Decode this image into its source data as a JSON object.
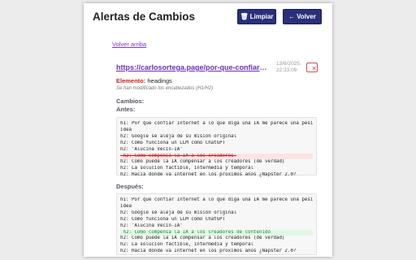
{
  "header": {
    "title": "Alertas de Cambios",
    "clear_label": "Limpiar",
    "back_label": "Volver",
    "clear_icon": "trash-icon",
    "back_icon": "arrow-left-icon"
  },
  "content": {
    "back_top": "Volver arriba",
    "url": "https://carlosortega.page/por-que-confiar-internet",
    "timestamp": "13/6/2025, 22:33:09",
    "close_glyph": "×",
    "element_label": "Elemento:",
    "element_value": "headings",
    "modified_text": "Se han modificado los encabezados (H1/H2)",
    "changes_label": "Cambios:",
    "before_label": "Antes:",
    "after_label": "Después:",
    "before_lines": [
      {
        "text": "h1: Por qué confiar Internet a lo que diga una IA me parece una pésima",
        "type": "normal"
      },
      {
        "text": "idea",
        "type": "normal"
      },
      {
        "text": "h2: Google se aleja de su misión original",
        "type": "normal"
      },
      {
        "text": "h2: Cómo funciona un LLM como ChatGPT",
        "type": "normal"
      },
      {
        "text": "h2: 'Alucina Vecin-IA'",
        "type": "normal"
      },
      {
        "text": " h2: Cómo compensa la IA a los creadores ",
        "type": "removed"
      },
      {
        "text": "h2: Cómo puede la IA compensar a los creadores (de verdad)",
        "type": "normal"
      },
      {
        "text": "h2: La solución factible, intermedia y temporal",
        "type": "normal"
      },
      {
        "text": "h2: Hacia dónde va Internet en los próximos años ¿Napster 2.0?",
        "type": "normal"
      }
    ],
    "after_lines": [
      {
        "text": "h1: Por qué confiar Internet a lo que diga una IA me parece una pésima",
        "type": "normal"
      },
      {
        "text": "idea",
        "type": "normal"
      },
      {
        "text": "h2: Google se aleja de su misión original",
        "type": "normal"
      },
      {
        "text": "h2: Cómo funciona un LLM como ChatGPT",
        "type": "normal"
      },
      {
        "text": "h2: 'Alucina Vecin-IA'",
        "type": "normal"
      },
      {
        "text": " h2: Cómo compensa la IA a los creadores de contenido ",
        "type": "added"
      },
      {
        "text": "h2: Cómo puede la IA compensar a los creadores (de verdad)",
        "type": "normal"
      },
      {
        "text": "h2: La solución factible, intermedia y temporal",
        "type": "normal"
      },
      {
        "text": "h2: Hacia dónde va Internet en los próximos años ¿Napster 2.0?",
        "type": "normal"
      }
    ]
  },
  "colors": {
    "button_bg": "#2a2f7a",
    "link": "#6a2fb8",
    "removed": "#c02020",
    "added": "#1e8a3a"
  }
}
